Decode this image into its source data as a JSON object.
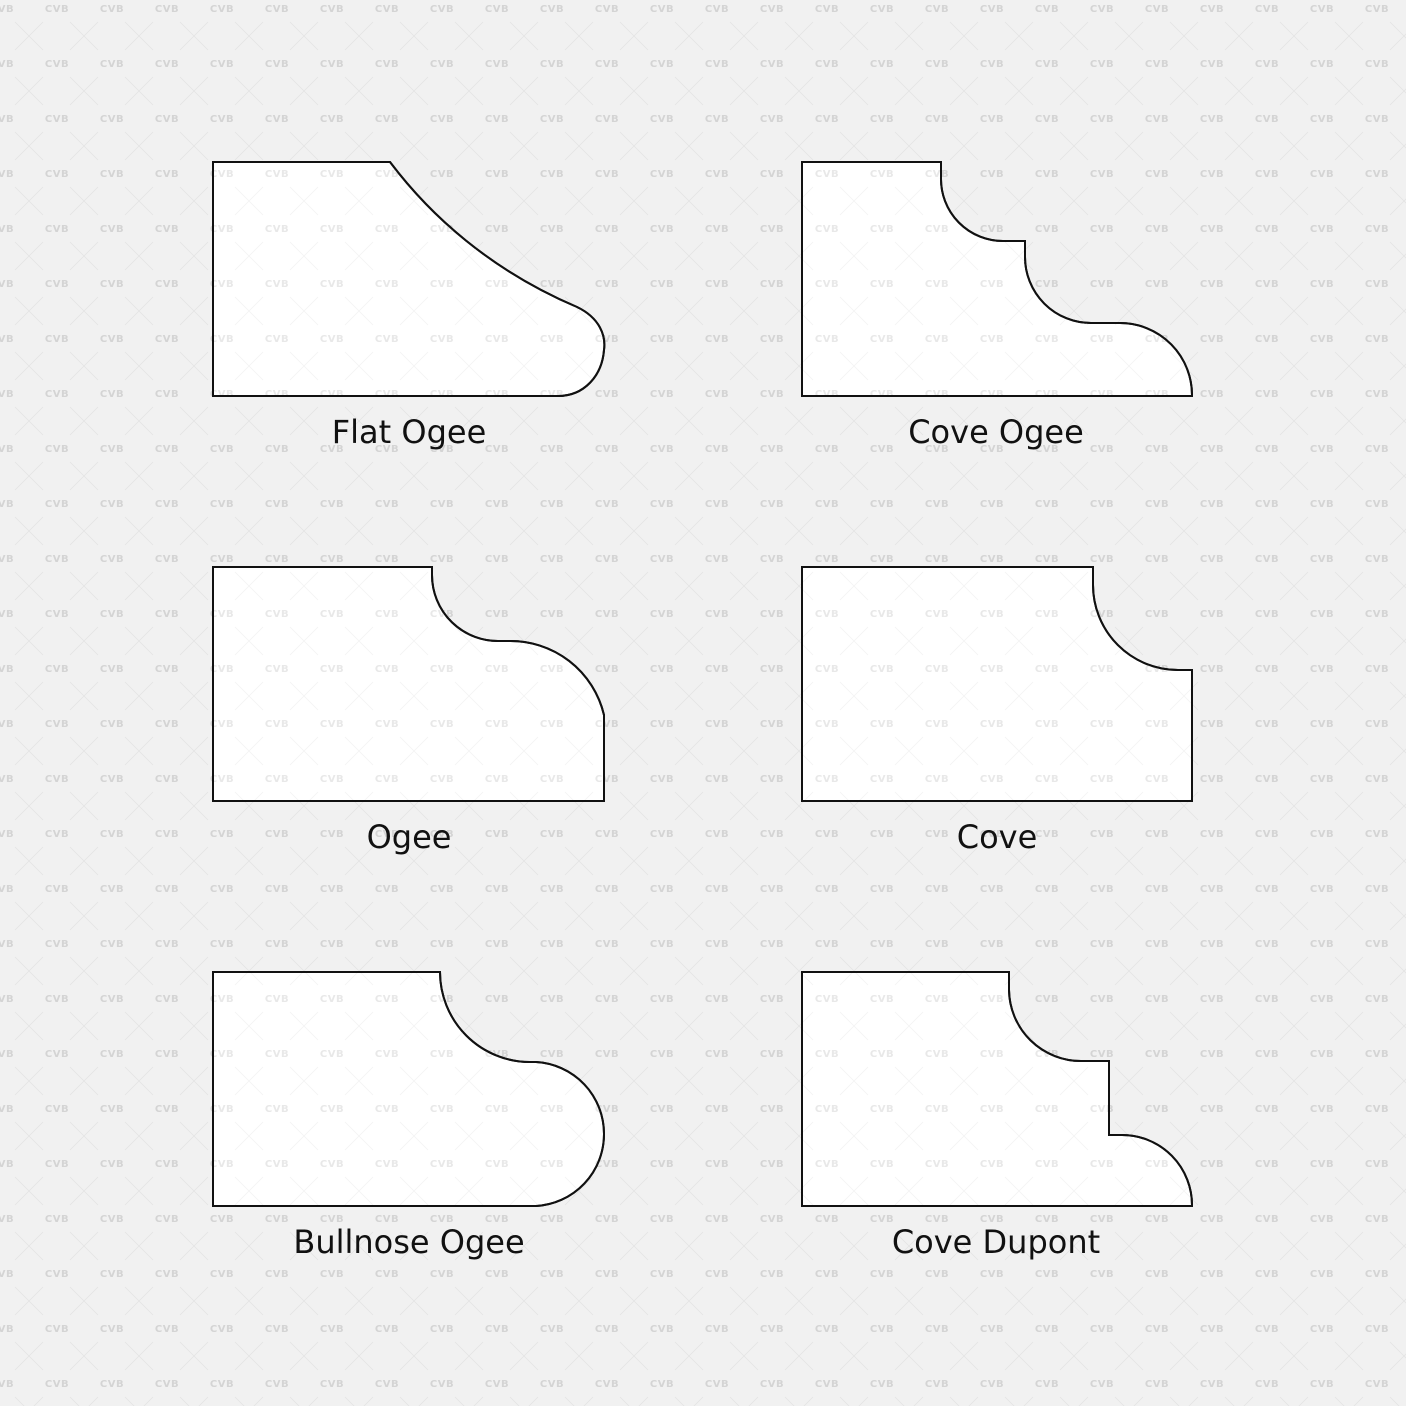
{
  "watermark": {
    "text": "CVB",
    "icon": "cross-mark"
  },
  "profiles": [
    {
      "id": "flat-ogee",
      "label": "Flat Ogee"
    },
    {
      "id": "cove-ogee",
      "label": "Cove Ogee"
    },
    {
      "id": "ogee",
      "label": "Ogee"
    },
    {
      "id": "cove",
      "label": "Cove"
    },
    {
      "id": "bullnose-ogee",
      "label": "Bullnose Ogee"
    },
    {
      "id": "cove-dupont",
      "label": "Cove Dupont"
    }
  ]
}
